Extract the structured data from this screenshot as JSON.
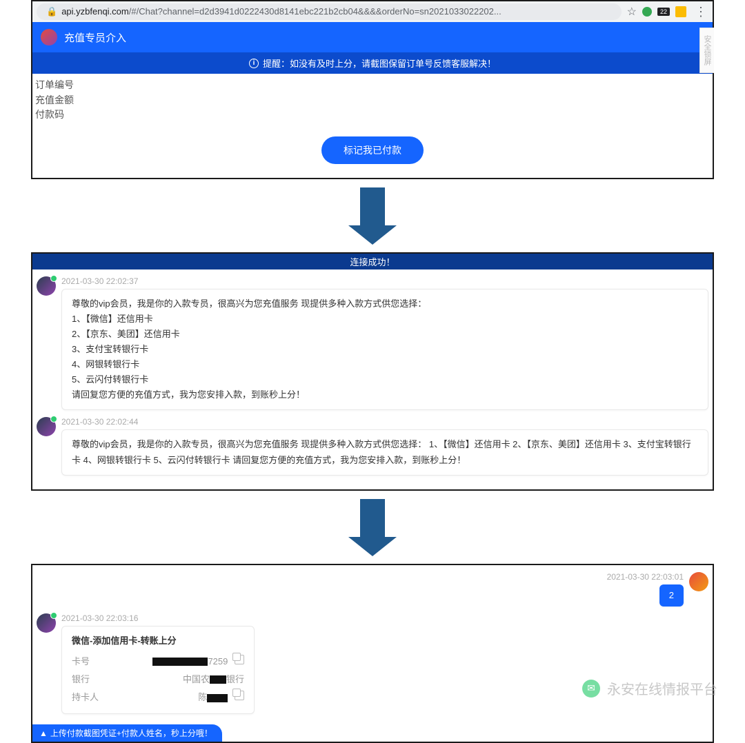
{
  "browser": {
    "url_prefix": "api.yzbfenqi.com",
    "url_path": "/#/Chat?channel=d2d3941d0222430d8141ebc221b2cb04&&&&orderNo=sn2021033022202...",
    "badge": "22"
  },
  "panel1": {
    "title": "充值专员介入",
    "notice": "提醒：如没有及时上分，请截图保留订单号反馈客服解决！",
    "rows": {
      "r1": "订单编号",
      "r2": "充值金额",
      "r3": "付款码"
    },
    "btn": "标记我已付款",
    "vtab": "安全锁屏"
  },
  "panel2": {
    "header": "连接成功！",
    "m1": {
      "time": "2021-03-30 22:02:37",
      "l1": "尊敬的vip会员，我是你的入款专员，很高兴为您充值服务 现提供多种入款方式供您选择：",
      "l2": "1、【微信】还信用卡",
      "l3": "2、【京东、美团】还信用卡",
      "l4": "3、支付宝转银行卡",
      "l5": "4、网银转银行卡",
      "l6": "5、云闪付转银行卡",
      "l7": "请回复您方便的充值方式，我为您安排入款，到账秒上分！"
    },
    "m2": {
      "time": "2021-03-30 22:02:44",
      "text": "尊敬的vip会员，我是你的入款专员，很高兴为您充值服务 现提供多种入款方式供您选择： 1、【微信】还信用卡 2、【京东、美团】还信用卡 3、支付宝转银行卡 4、网银转银行卡 5、云闪付转银行卡 请回复您方便的充值方式，我为您安排入款，到账秒上分！"
    }
  },
  "panel3": {
    "m3": {
      "time": "2021-03-30 22:03:01",
      "text": "2"
    },
    "m4": {
      "time": "2021-03-30 22:03:16",
      "title": "微信-添加信用卡-转账上分",
      "card_no_label": "卡号",
      "card_no_suffix": "7259",
      "bank_label": "银行",
      "bank_prefix": "中国农",
      "bank_suffix": "银行",
      "holder_label": "持卡人",
      "holder_prefix": "陈"
    },
    "upload": "上传付款截图凭证+付款人姓名，秒上分哦！"
  },
  "watermark": "永安在线情报平台"
}
